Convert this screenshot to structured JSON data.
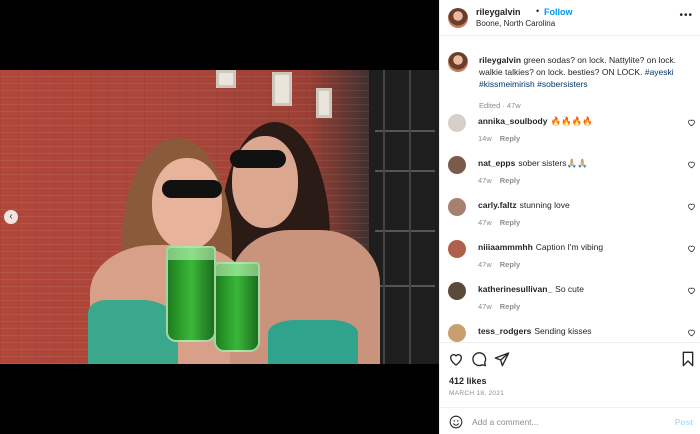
{
  "post": {
    "username": "rileygalvin",
    "separator": "•",
    "follow_label": "Follow",
    "location": "Boone, North Carolina",
    "more_icon": "more-horizontal-icon"
  },
  "caption": {
    "username": "rileygalvin",
    "text": "green sodas? on lock. Nattylite? on lock. walkie talkies? on lock. besties? ON LOCK.",
    "hashtags": [
      "#ayeski",
      "#kissmeimirish",
      "#sobersisters"
    ],
    "edited": "Edited · 47w"
  },
  "comments": [
    {
      "username": "annika_soulbody",
      "text": "🔥🔥🔥🔥",
      "time": "14w",
      "reply_label": "Reply",
      "avatar_color": "#d8d0c8"
    },
    {
      "username": "nat_epps",
      "text": "sober sisters🙏🏼🙏🏼",
      "time": "47w",
      "reply_label": "Reply",
      "avatar_color": "#7a5a4a"
    },
    {
      "username": "carly.faltz",
      "text": "stunning love",
      "time": "47w",
      "reply_label": "Reply",
      "avatar_color": "#a88070"
    },
    {
      "username": "niiiaammmhh",
      "text": "Caption I'm vibing",
      "time": "47w",
      "reply_label": "Reply",
      "avatar_color": "#b0604a"
    },
    {
      "username": "katherinesullivan_",
      "text": "So cute",
      "time": "47w",
      "reply_label": "Reply",
      "avatar_color": "#5a4a3a"
    },
    {
      "username": "tess_rodgers",
      "text": "Sending kisses",
      "time": "",
      "reply_label": "",
      "avatar_color": "#c8a070"
    }
  ],
  "actions": {
    "icons": [
      "heart-icon",
      "comment-icon",
      "share-icon",
      "bookmark-icon"
    ],
    "likes": "412 likes",
    "date": "MARCH 18, 2021"
  },
  "add_comment": {
    "placeholder": "Add a comment...",
    "post_label": "Post"
  },
  "colors": {
    "accent": "#0095f6",
    "hashtag": "#00376b",
    "muted": "#8e8e8e",
    "post_disabled": "#b2dffc"
  }
}
